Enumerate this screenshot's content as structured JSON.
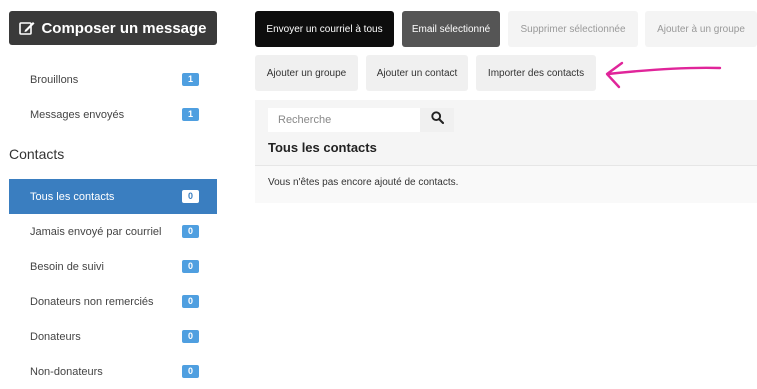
{
  "sidebar": {
    "compose_label": "Composer un message",
    "items": [
      {
        "label": "Brouillons",
        "count": "1"
      },
      {
        "label": "Messages envoyés",
        "count": "1"
      }
    ],
    "contacts_heading": "Contacts",
    "contact_filters": [
      {
        "label": "Tous les contacts",
        "count": "0",
        "active": true
      },
      {
        "label": "Jamais envoyé par courriel",
        "count": "0"
      },
      {
        "label": "Besoin de suivi",
        "count": "0"
      },
      {
        "label": "Donateurs non remerciés",
        "count": "0"
      },
      {
        "label": "Donateurs",
        "count": "0"
      },
      {
        "label": "Non-donateurs",
        "count": "0"
      }
    ]
  },
  "toolbar": {
    "row1": [
      {
        "label": "Envoyer un courriel à tous",
        "style": "black"
      },
      {
        "label": "Email sélectionné",
        "style": "dark"
      },
      {
        "label": "Supprimer sélectionnée",
        "style": "light"
      },
      {
        "label": "Ajouter à un groupe",
        "style": "light"
      }
    ],
    "row2": [
      {
        "label": "Ajouter un groupe"
      },
      {
        "label": "Ajouter un contact"
      },
      {
        "label": "Importer des contacts"
      }
    ]
  },
  "annotation": {
    "color": "#e0259a",
    "icon": "arrow-left-icon"
  },
  "main": {
    "search_placeholder": "Recherche",
    "title": "Tous les contacts",
    "empty_message": "Vous n'êtes pas encore ajouté de contacts."
  },
  "colors": {
    "accent": "#3a7ec0",
    "badge": "#4f9fe0"
  }
}
